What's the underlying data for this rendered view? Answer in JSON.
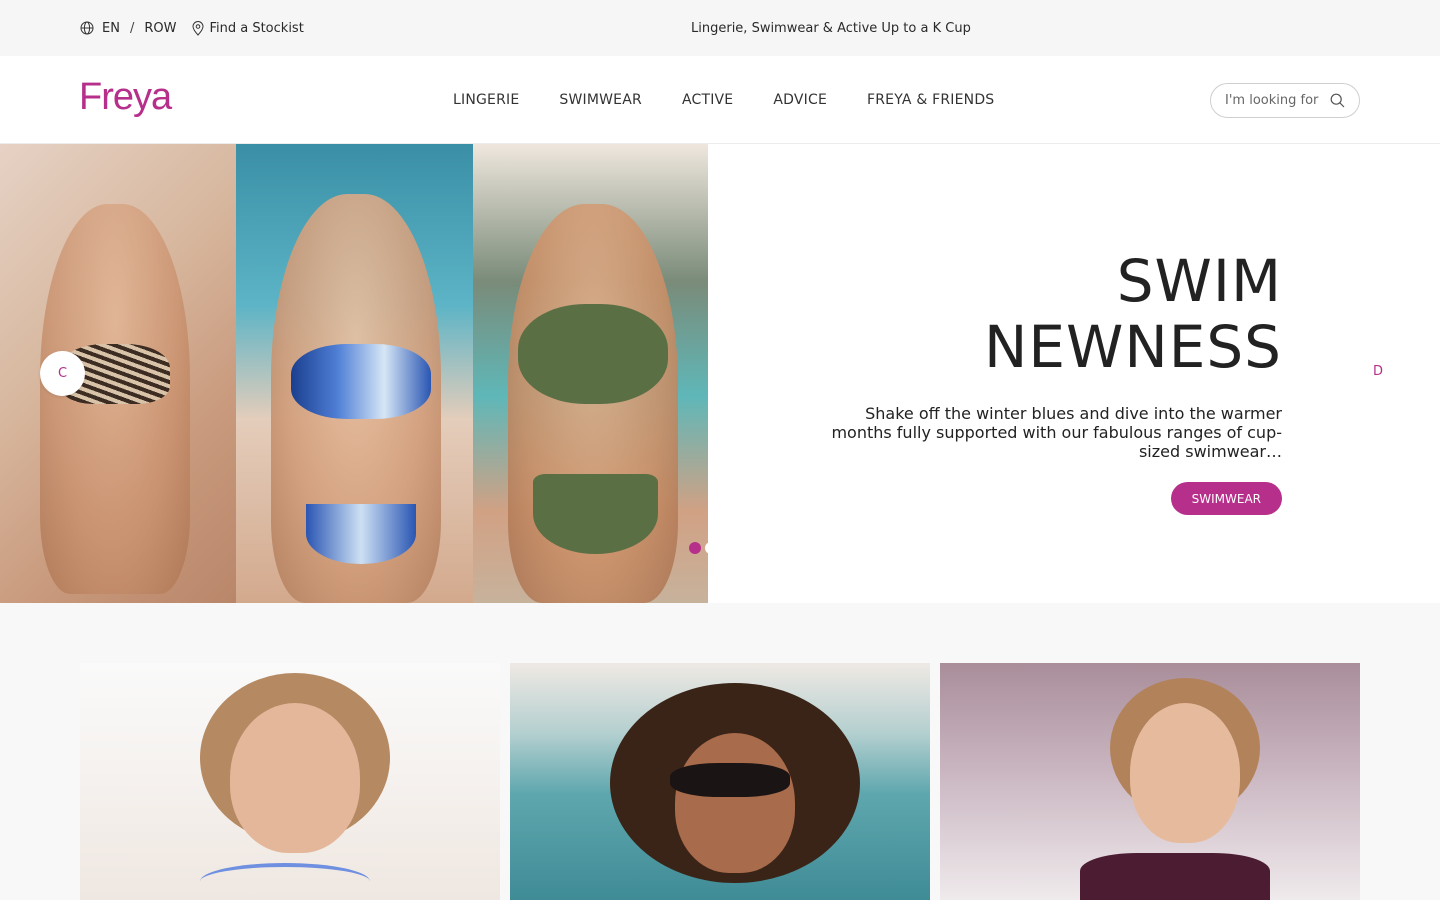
{
  "topbar": {
    "language": "EN",
    "separator": "/",
    "region": "ROW",
    "stockist_label": "Find a Stockist",
    "promo_text": "Lingerie, Swimwear & Active Up to a K Cup"
  },
  "header": {
    "logo": "Freya",
    "nav": [
      "LINGERIE",
      "SWIMWEAR",
      "ACTIVE",
      "ADVICE",
      "FREYA & FRIENDS"
    ],
    "search_placeholder": "I'm looking for"
  },
  "hero": {
    "title_line1": "SWIM",
    "title_line2": "NEWNESS",
    "description": "Shake off the winter blues and dive into the warmer months fully supported with our fabulous ranges of cup-sized swimwear…",
    "cta_label": "SWIMWEAR",
    "prev_label": "C",
    "next_label": "D",
    "slide_count": 2,
    "active_slide": 1
  },
  "colors": {
    "brand": "#b62f8b",
    "topbar_bg": "#f6f6f6",
    "cards_bg": "#f8f8f8"
  },
  "icons": {
    "language": "globe-icon",
    "stockist": "map-pin-icon",
    "search": "search-icon"
  }
}
